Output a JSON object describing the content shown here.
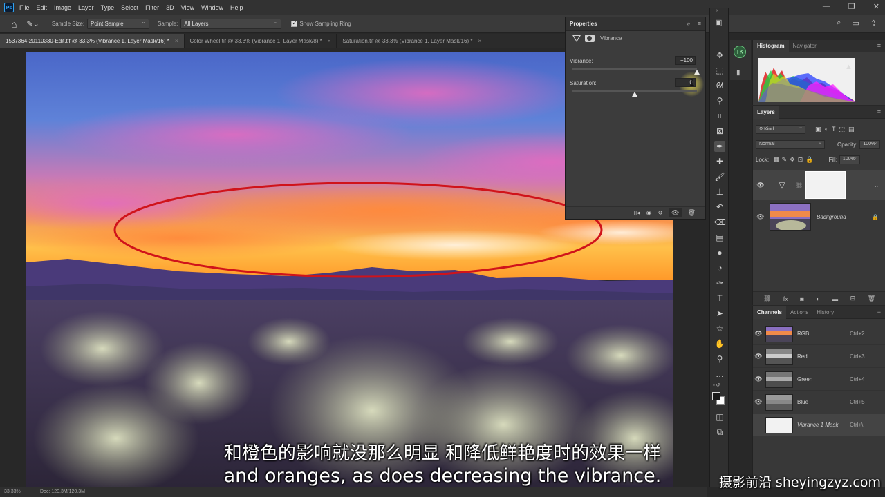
{
  "app": {
    "logo": "Ps",
    "menu": [
      "File",
      "Edit",
      "Image",
      "Layer",
      "Type",
      "Select",
      "Filter",
      "3D",
      "View",
      "Window",
      "Help"
    ],
    "window_controls": [
      "—",
      "❐",
      "✕"
    ]
  },
  "options_bar": {
    "sample_size_label": "Sample Size:",
    "sample_size_value": "Point Sample",
    "sample_label": "Sample:",
    "sample_value": "All Layers",
    "show_ring_label": "Show Sampling Ring"
  },
  "tabs": [
    {
      "label": "1537364-20110330-Edit.tif @ 33.3% (Vibrance 1, Layer Mask/16) *",
      "active": true
    },
    {
      "label": "Color Wheel.tif @ 33.3% (Vibrance 1, Layer Mask/8) *",
      "active": false
    },
    {
      "label": "Saturation.tif @ 33.3% (Vibrance 1, Layer Mask/16) *",
      "active": false
    }
  ],
  "status_bar": {
    "zoom": "33.33%",
    "doc": "Doc: 120.3M/120.3M"
  },
  "properties": {
    "title": "Properties",
    "layer_name": "Vibrance",
    "vibrance_label": "Vibrance:",
    "vibrance_value": "+100",
    "vibrance_level": 100,
    "saturation_label": "Saturation:",
    "saturation_value": "0",
    "saturation_level": 0,
    "slider_range": [
      -100,
      100
    ]
  },
  "toolbar": {
    "tools": [
      "move-icon",
      "marquee-icon",
      "lasso-icon",
      "quick-select-icon",
      "crop-icon",
      "frame-icon",
      "eyedropper-icon",
      "healing-icon",
      "brush-icon",
      "stamp-icon",
      "history-brush-icon",
      "eraser-icon",
      "gradient-icon",
      "blur-icon",
      "dodge-icon",
      "pen-icon",
      "type-icon",
      "path-select-icon",
      "shape-icon",
      "hand-icon",
      "zoom-icon",
      "more-icon"
    ],
    "active_tool": "eyedropper-icon"
  },
  "histogram": {
    "tabs": [
      "Histogram",
      "Navigator"
    ]
  },
  "layers": {
    "title": "Layers",
    "filter_kind": "Kind",
    "blend_mode": "Normal",
    "opacity_label": "Opacity:",
    "opacity_value": "100%",
    "lock_label": "Lock:",
    "fill_label": "Fill:",
    "fill_value": "100%",
    "items": [
      {
        "name": "",
        "type": "adjustment"
      },
      {
        "name": "Background",
        "type": "image"
      }
    ]
  },
  "channels": {
    "tabs": [
      "Channels",
      "Actions",
      "History"
    ],
    "items": [
      {
        "name": "RGB",
        "shortcut": "Ctrl+2"
      },
      {
        "name": "Red",
        "shortcut": "Ctrl+3"
      },
      {
        "name": "Green",
        "shortcut": "Ctrl+4"
      },
      {
        "name": "Blue",
        "shortcut": "Ctrl+5"
      },
      {
        "name": "Vibrance 1 Mask",
        "shortcut": "Ctrl+\\"
      }
    ]
  },
  "subtitles": {
    "chinese": "和橙色的影响就没那么明显 和降低鲜艳度时的效果一样",
    "english": "and oranges, as does decreasing the vibrance.",
    "watermark": "摄影前沿 sheyingzyz.com"
  },
  "colors": {
    "annotation_ellipse": "#d0131a",
    "accent_blue": "#31a8ff"
  }
}
